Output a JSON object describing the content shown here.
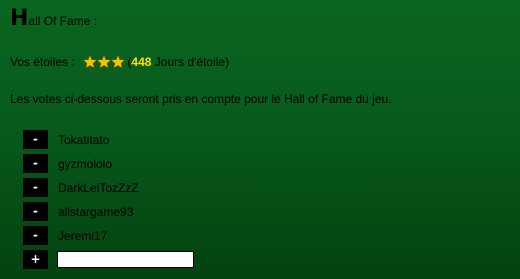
{
  "title": {
    "dropcap": "H",
    "rest": "all Of Fame :"
  },
  "stars": {
    "label": "Vos étoiles :",
    "star_count": 3,
    "star_color": "#e8c800",
    "paren_open": " (",
    "count": "448",
    "suffix": " Jours d'étoile)"
  },
  "notice": "Les votes ci-dessous seront pris en compte pour le Hall of Fame du jeu.",
  "votes": {
    "remove_label": "-",
    "add_label": "+",
    "items": [
      "Tokatitato",
      "gyzmololo",
      "DarkLeiTozZzZ",
      "allstargame93",
      "Jeremi17"
    ],
    "new_value": ""
  },
  "colors": {
    "background_top": "#0a6620",
    "background_bottom": "#03420f",
    "highlight": "#ffe000"
  }
}
